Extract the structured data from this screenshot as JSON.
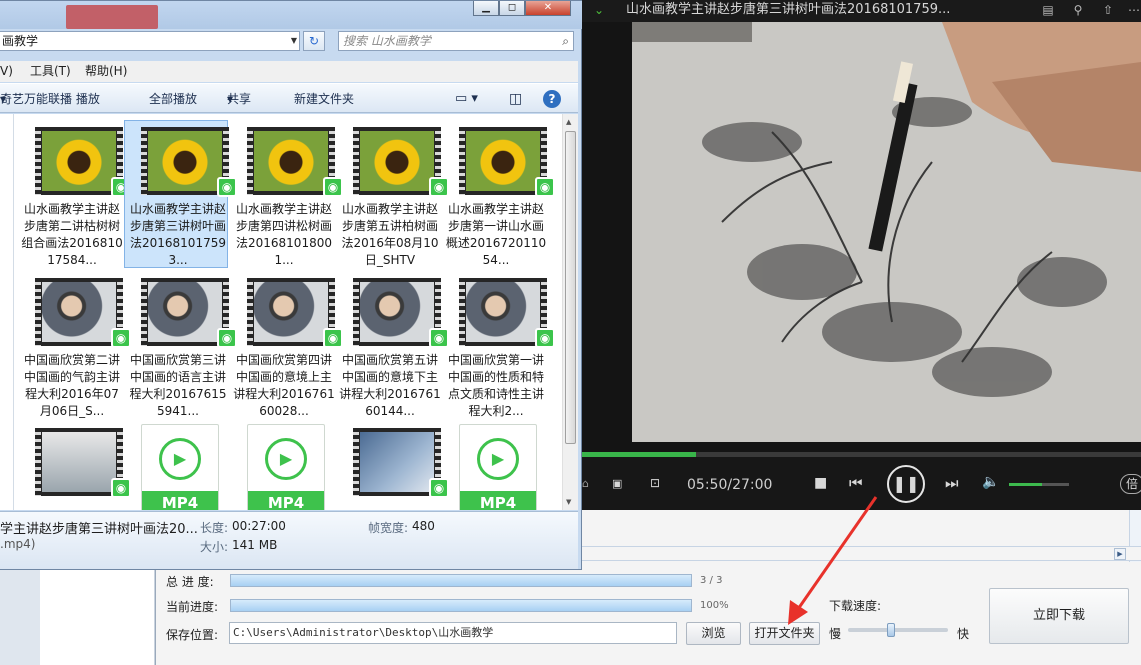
{
  "explorer": {
    "address": "画教学",
    "search_placeholder": "搜索 山水画教学",
    "menu": {
      "view": "V)",
      "tools": "工具(T)",
      "help": "帮助(H)"
    },
    "toolbar": {
      "player": "奇艺万能联播 播放",
      "play_all": "全部播放",
      "share": "共享",
      "new_folder": "新建文件夹"
    },
    "files": [
      {
        "thumb": "sunflower",
        "name": "山水画教学主讲赵步唐第二讲枯树树组合画法201681017584..."
      },
      {
        "thumb": "sunflower",
        "name": "山水画教学主讲赵步唐第三讲树叶画法201681017593...",
        "selected": true
      },
      {
        "thumb": "sunflower",
        "name": "山水画教学主讲赵步唐第四讲松树画法201681018001..."
      },
      {
        "thumb": "sunflower",
        "name": "山水画教学主讲赵步唐第五讲柏树画法2016年08月10日_SHTV"
      },
      {
        "thumb": "sunflower",
        "name": "山水画教学主讲赵步唐第一讲山水画概述201672011054..."
      },
      {
        "thumb": "portrait",
        "name": "中国画欣赏第二讲中国画的气韵主讲程大利2016年07月06日_S..."
      },
      {
        "thumb": "portrait",
        "name": "中国画欣赏第三讲中国画的语言主讲程大利201676155941..."
      },
      {
        "thumb": "portrait",
        "name": "中国画欣赏第四讲中国画的意境上主讲程大利201676160028..."
      },
      {
        "thumb": "portrait",
        "name": "中国画欣赏第五讲中国画的意境下主讲程大利201676160144..."
      },
      {
        "thumb": "portrait",
        "name": "中国画欣赏第一讲中国画的性质和特点文质和诗性主讲程大利2..."
      },
      {
        "thumb": "slide",
        "name": ""
      },
      {
        "thumb": "mp4",
        "name": "",
        "label": "MP4"
      },
      {
        "thumb": "mp4",
        "name": "",
        "label": "MP4"
      },
      {
        "thumb": "slide2",
        "name": ""
      },
      {
        "thumb": "mp4",
        "name": "",
        "label": "MP4"
      }
    ],
    "details": {
      "filename": "学主讲赵步唐第三讲树叶画法20...",
      "filetype": ".mp4)",
      "length_label": "长度:",
      "length_value": "00:27:00",
      "size_label": "大小:",
      "size_value": "141 MB",
      "framewidth_label": "帧宽度:",
      "framewidth_value": "480"
    }
  },
  "player": {
    "title": "山水画教学主讲赵步唐第三讲树叶画法20168101759...",
    "time": "05:50/27:00",
    "progress_fraction": 0.204,
    "volume_fraction": 0.55,
    "speed_badge": "倍"
  },
  "downloader": {
    "total_progress_label": "总 进 度:",
    "total_progress_value": "3 / 3",
    "total_progress_fraction": 1.0,
    "current_progress_label": "当前进度:",
    "current_progress_value": "100%",
    "current_progress_fraction": 1.0,
    "save_label": "保存位置:",
    "save_path": "C:\\Users\\Administrator\\Desktop\\山水画教学",
    "browse_button": "浏览",
    "open_folder_button": "打开文件夹",
    "speed_label": "下载速度:",
    "slow_label": "慢",
    "fast_label": "快",
    "download_now_button": "立即下载",
    "accent": "#e8322b"
  }
}
